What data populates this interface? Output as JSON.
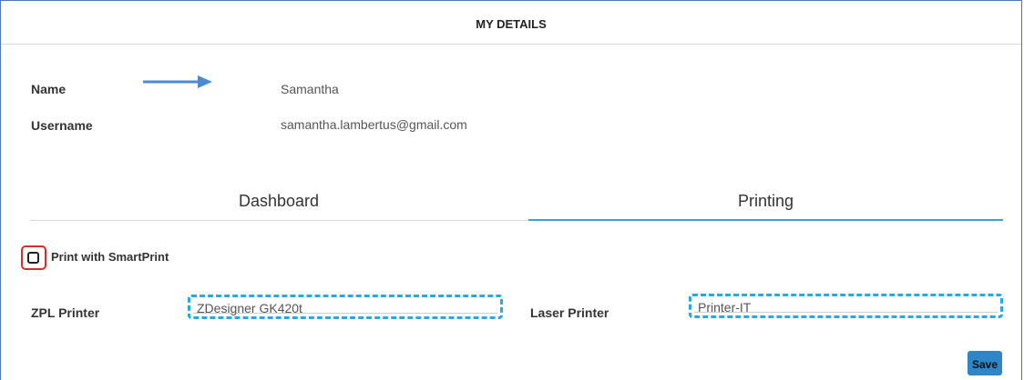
{
  "header": {
    "title": "MY DETAILS"
  },
  "details": {
    "name_label": "Name",
    "name_value": "Samantha",
    "username_label": "Username",
    "username_value": "samantha.lambertus@gmail.com"
  },
  "tabs": [
    {
      "label": "Dashboard",
      "active": false
    },
    {
      "label": "Printing",
      "active": true
    }
  ],
  "printing": {
    "smartprint_label": "Print with SmartPrint",
    "smartprint_checked": false,
    "zpl_label": "ZPL Printer",
    "zpl_value": "ZDesigner GK420t",
    "laser_label": "Laser Printer",
    "laser_value": "Printer-IT",
    "save_label": "Save"
  },
  "colors": {
    "frame_border": "#4a78b8",
    "active_tab_underline": "#3fa0d4",
    "field_highlight": "#2aa8e0",
    "checkbox_highlight": "#d62d2d",
    "arrow": "#4a8ad0",
    "save_button": "#2f86c6"
  },
  "icons": {
    "pointer": "arrow-right-icon"
  }
}
